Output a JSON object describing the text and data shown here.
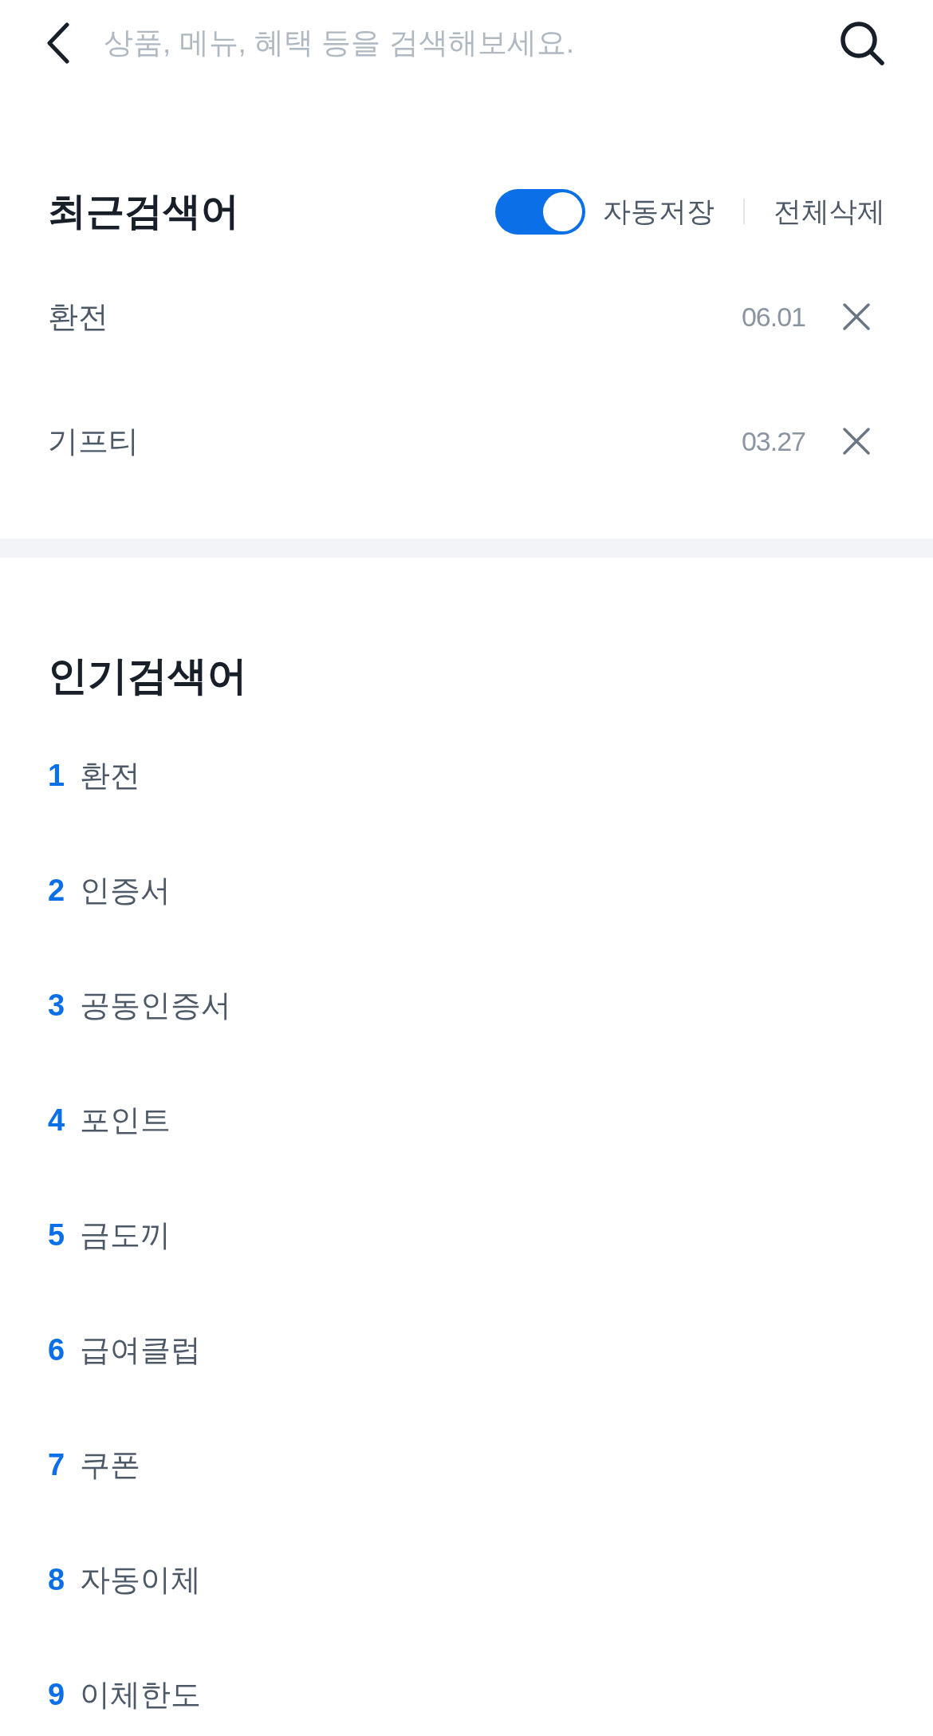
{
  "search_bar": {
    "placeholder": "상품, 메뉴, 혜택 등을 검색해보세요."
  },
  "recent_searches": {
    "title": "최근검색어",
    "auto_save": {
      "label": "자동저장",
      "on": true
    },
    "delete_all": "전체삭제",
    "items": [
      {
        "term": "환전",
        "date": "06.01"
      },
      {
        "term": "기프티",
        "date": "03.27"
      }
    ]
  },
  "popular_searches": {
    "title": "인기검색어",
    "items": [
      {
        "rank": "1",
        "term": "환전"
      },
      {
        "rank": "2",
        "term": "인증서"
      },
      {
        "rank": "3",
        "term": "공동인증서"
      },
      {
        "rank": "4",
        "term": "포인트"
      },
      {
        "rank": "5",
        "term": "금도끼"
      },
      {
        "rank": "6",
        "term": "급여클럽"
      },
      {
        "rank": "7",
        "term": "쿠폰"
      },
      {
        "rank": "8",
        "term": "자동이체"
      },
      {
        "rank": "9",
        "term": "이체한도"
      }
    ]
  }
}
